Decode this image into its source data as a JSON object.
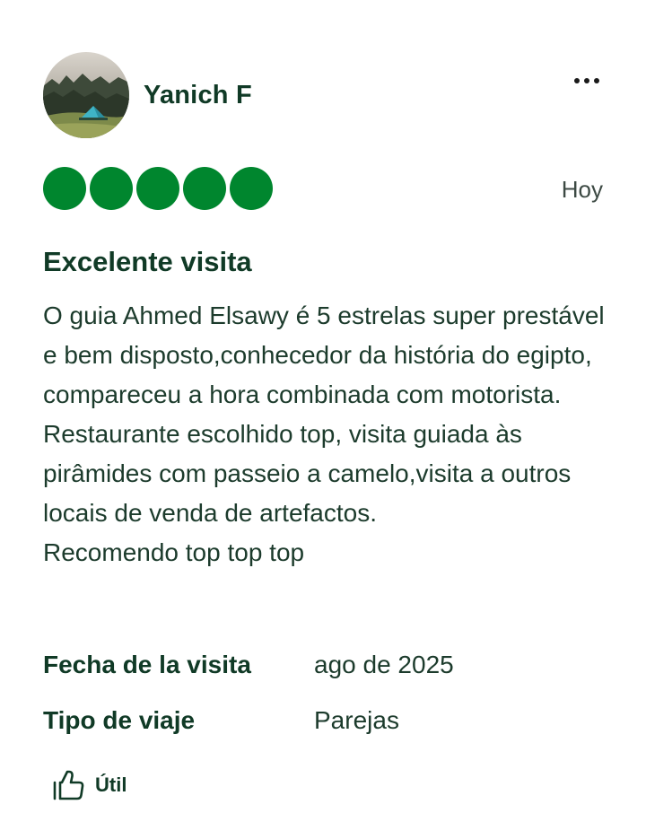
{
  "review": {
    "author": {
      "name": "Yanich F",
      "avatar": "camping-tent-photo"
    },
    "rating": {
      "value": 5,
      "max": 5,
      "color": "#00862e"
    },
    "date": "Hoy",
    "title": "Excelente visita",
    "body": [
      "O guia Ahmed Elsawy é 5 estrelas super prestável e bem disposto,conhecedor da história do egipto, compareceu a hora combinada com motorista.",
      "Restaurante escolhido top, visita guiada às pirâmides com passeio a camelo,visita a outros locais de venda de artefactos.",
      "Recomendo top top top"
    ],
    "details": [
      {
        "label": "Fecha de la visita",
        "value": "ago de 2025"
      },
      {
        "label": "Tipo de viaje",
        "value": "Parejas"
      }
    ],
    "helpful_label": "Útil"
  },
  "icons": {
    "more": "more-horizontal-icon",
    "helpful": "thumbs-up-icon"
  }
}
